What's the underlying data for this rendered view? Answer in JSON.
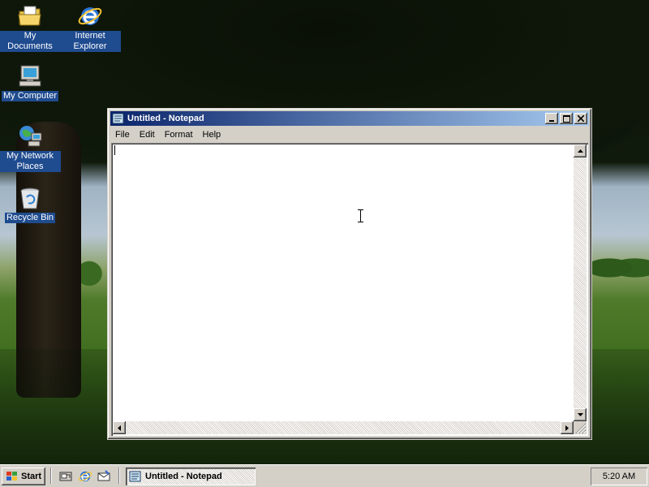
{
  "desktop": {
    "icons": [
      {
        "label": "My Documents",
        "icon": "folder-documents-icon"
      },
      {
        "label": "Internet Explorer",
        "icon": "internet-explorer-icon"
      },
      {
        "label": "My Computer",
        "icon": "computer-icon"
      },
      {
        "label": "My Network Places",
        "icon": "network-places-icon"
      },
      {
        "label": "Recycle Bin",
        "icon": "recycle-bin-icon"
      }
    ]
  },
  "window": {
    "title": "Untitled - Notepad",
    "menu": [
      "File",
      "Edit",
      "Format",
      "Help"
    ],
    "content": "",
    "colors": {
      "titlebar_start": "#0a246a",
      "titlebar_end": "#a6caf0"
    }
  },
  "taskbar": {
    "start_label": "Start",
    "quick_launch": [
      "show-desktop-icon",
      "internet-explorer-icon",
      "outlook-express-icon"
    ],
    "task_label": "Untitled - Notepad",
    "clock": "5:20 AM"
  }
}
